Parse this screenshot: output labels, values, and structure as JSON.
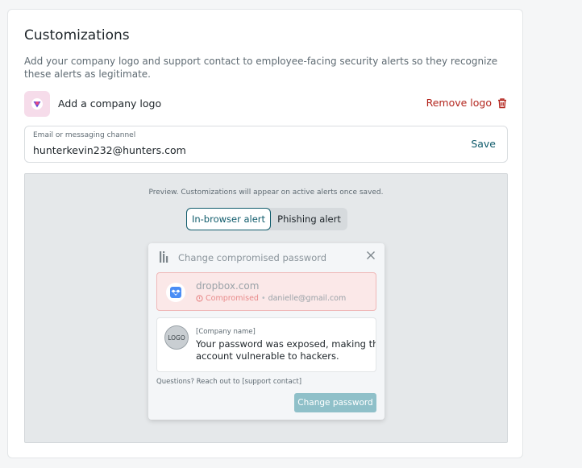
{
  "customizations": {
    "title": "Customizations",
    "description": "Add your company logo and support contact to employee-facing security alerts so they recognize these alerts as legitimate.",
    "logo": {
      "label": "Add a company logo",
      "remove_label": "Remove logo"
    },
    "contact": {
      "label": "Email or messaging channel",
      "value": "hunterkevin232@hunters.com",
      "save_label": "Save"
    }
  },
  "preview": {
    "note": "Preview. Customizations will appear on active alerts once saved.",
    "tabs": [
      {
        "label": "In-browser alert",
        "active": true
      },
      {
        "label": "Phishing alert",
        "active": false
      }
    ],
    "alert": {
      "title": "Change compromised password",
      "site": {
        "name": "dropbox.com",
        "status": "Compromised",
        "separator": "•",
        "email": "danielle@gmail.com"
      },
      "message": {
        "logo_text": "LOGO",
        "company": "[Company name]",
        "text_line1": "Your password was exposed, making this",
        "text_line2": "account vulnerable to hackers."
      },
      "support": "Questions? Reach out to [support contact]",
      "button": "Change password"
    }
  },
  "colors": {
    "accent": "#0f5b6b",
    "danger": "#b3261e",
    "compromised_bg": "#fbe8e8",
    "button_disabled": "#8fc0c9"
  }
}
